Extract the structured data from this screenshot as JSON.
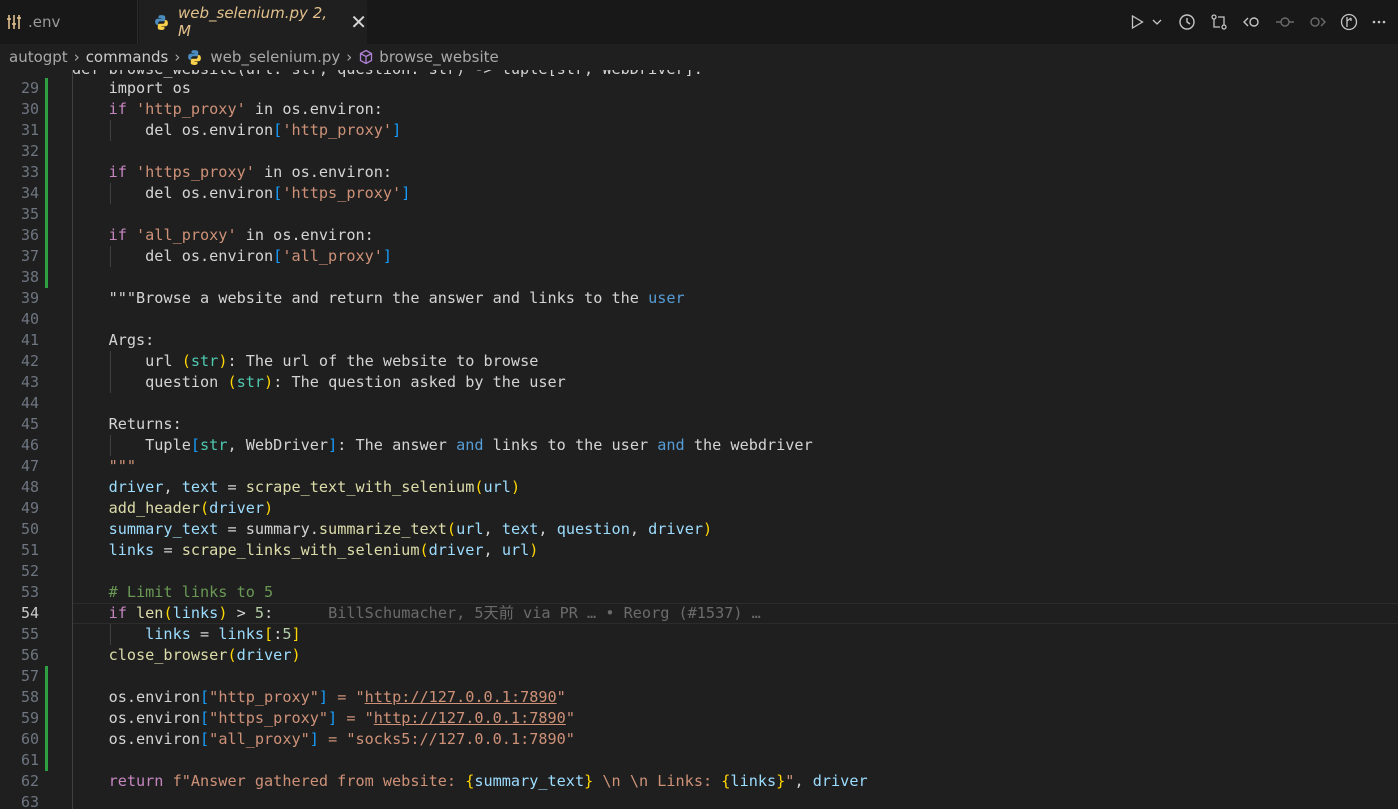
{
  "tabs": [
    {
      "label": ".env",
      "icon": "settings-sliders-icon",
      "active": false
    },
    {
      "label": "web_selenium.py",
      "status": "2, M",
      "icon": "python-icon",
      "active": true
    }
  ],
  "toolbar": {
    "icons": [
      "run-icon",
      "chevron-down-icon",
      "history-icon",
      "compare-changes-icon",
      "go-back-icon",
      "commit-icon",
      "go-forward-icon",
      "git-graph-icon",
      "more-icon"
    ]
  },
  "breadcrumb": {
    "items": [
      "autogpt",
      "commands",
      "web_selenium.py",
      "browse_website"
    ]
  },
  "editor": {
    "current_line": 54,
    "top_partial": "def browse_website(url: str, question: str) -> tuple[str, WebDriver]:",
    "last_partial_number": "63",
    "lines": [
      {
        "n": "29",
        "mod": true,
        "spans": [
          [
            "    import os",
            "d"
          ]
        ]
      },
      {
        "n": "30",
        "mod": true,
        "spans": [
          [
            "    if ",
            "k"
          ],
          [
            "'http_proxy'",
            "s"
          ],
          [
            " in os.environ:",
            "d"
          ]
        ]
      },
      {
        "n": "31",
        "mod": true,
        "spans": [
          [
            "        del os.environ",
            "d"
          ],
          [
            "[",
            "b3"
          ],
          [
            "'http_proxy'",
            "s"
          ],
          [
            "]",
            "b3"
          ]
        ]
      },
      {
        "n": "32",
        "mod": true,
        "spans": []
      },
      {
        "n": "33",
        "mod": true,
        "spans": [
          [
            "    if ",
            "k"
          ],
          [
            "'https_proxy'",
            "s"
          ],
          [
            " in os.environ:",
            "d"
          ]
        ]
      },
      {
        "n": "34",
        "mod": true,
        "spans": [
          [
            "        del os.environ",
            "d"
          ],
          [
            "[",
            "b3"
          ],
          [
            "'https_proxy'",
            "s"
          ],
          [
            "]",
            "b3"
          ]
        ]
      },
      {
        "n": "35",
        "mod": true,
        "spans": []
      },
      {
        "n": "36",
        "mod": true,
        "spans": [
          [
            "    if ",
            "k"
          ],
          [
            "'all_proxy'",
            "s"
          ],
          [
            " in os.environ:",
            "d"
          ]
        ]
      },
      {
        "n": "37",
        "mod": true,
        "spans": [
          [
            "        del os.environ",
            "d"
          ],
          [
            "[",
            "b3"
          ],
          [
            "'all_proxy'",
            "s"
          ],
          [
            "]",
            "b3"
          ]
        ]
      },
      {
        "n": "38",
        "mod": true,
        "spans": []
      },
      {
        "n": "39",
        "mod": false,
        "spans": [
          [
            "    \"\"\"Browse a website and return the answer and links to the ",
            "d"
          ],
          [
            "user",
            "bl"
          ]
        ]
      },
      {
        "n": "40",
        "mod": false,
        "spans": []
      },
      {
        "n": "41",
        "mod": false,
        "spans": [
          [
            "    Args:",
            "d"
          ]
        ]
      },
      {
        "n": "42",
        "mod": false,
        "spans": [
          [
            "        url ",
            "d"
          ],
          [
            "(",
            "b1"
          ],
          [
            "str",
            "cl"
          ],
          [
            ")",
            "b1"
          ],
          [
            ": The url of the website to browse",
            "d"
          ]
        ]
      },
      {
        "n": "43",
        "mod": false,
        "spans": [
          [
            "        question ",
            "d"
          ],
          [
            "(",
            "b1"
          ],
          [
            "str",
            "cl"
          ],
          [
            ")",
            "b1"
          ],
          [
            ": The question asked by the user",
            "d"
          ]
        ]
      },
      {
        "n": "44",
        "mod": false,
        "spans": []
      },
      {
        "n": "45",
        "mod": false,
        "spans": [
          [
            "    Returns:",
            "d"
          ]
        ]
      },
      {
        "n": "46",
        "mod": false,
        "spans": [
          [
            "        Tuple",
            "d"
          ],
          [
            "[",
            "b3"
          ],
          [
            "str",
            "cl"
          ],
          [
            ", WebDriver",
            "d"
          ],
          [
            "]",
            "b3"
          ],
          [
            ": The answer ",
            "d"
          ],
          [
            "and",
            "bl"
          ],
          [
            " links to the user ",
            "d"
          ],
          [
            "and",
            "bl"
          ],
          [
            " the webdriver",
            "d"
          ]
        ]
      },
      {
        "n": "47",
        "mod": false,
        "spans": [
          [
            "    \"\"\"",
            "s"
          ]
        ]
      },
      {
        "n": "48",
        "mod": false,
        "spans": [
          [
            "    driver",
            "v"
          ],
          [
            ", ",
            "d"
          ],
          [
            "text",
            "v"
          ],
          [
            " = ",
            "d"
          ],
          [
            "scrape_text_with_selenium",
            "f"
          ],
          [
            "(",
            "b1"
          ],
          [
            "url",
            "v"
          ],
          [
            ")",
            "b1"
          ]
        ]
      },
      {
        "n": "49",
        "mod": false,
        "spans": [
          [
            "    add_header",
            "f"
          ],
          [
            "(",
            "b1"
          ],
          [
            "driver",
            "v"
          ],
          [
            ")",
            "b1"
          ]
        ]
      },
      {
        "n": "50",
        "mod": false,
        "spans": [
          [
            "    summary_text",
            "v"
          ],
          [
            " = summary.",
            "d"
          ],
          [
            "summarize_text",
            "f"
          ],
          [
            "(",
            "b1"
          ],
          [
            "url",
            "v"
          ],
          [
            ", ",
            "d"
          ],
          [
            "text",
            "v"
          ],
          [
            ", ",
            "d"
          ],
          [
            "question",
            "v"
          ],
          [
            ", ",
            "d"
          ],
          [
            "driver",
            "v"
          ],
          [
            ")",
            "b1"
          ]
        ]
      },
      {
        "n": "51",
        "mod": false,
        "spans": [
          [
            "    links",
            "v"
          ],
          [
            " = ",
            "d"
          ],
          [
            "scrape_links_with_selenium",
            "f"
          ],
          [
            "(",
            "b1"
          ],
          [
            "driver",
            "v"
          ],
          [
            ", ",
            "d"
          ],
          [
            "url",
            "v"
          ],
          [
            ")",
            "b1"
          ]
        ]
      },
      {
        "n": "52",
        "mod": false,
        "spans": []
      },
      {
        "n": "53",
        "mod": false,
        "spans": [
          [
            "    # Limit links to 5",
            "c"
          ]
        ]
      },
      {
        "n": "54",
        "mod": false,
        "spans": [
          [
            "    if ",
            "k"
          ],
          [
            "len",
            "f"
          ],
          [
            "(",
            "b1"
          ],
          [
            "links",
            "v"
          ],
          [
            ")",
            "b1"
          ],
          [
            " > ",
            "d"
          ],
          [
            "5",
            "n"
          ],
          [
            ":",
            "d"
          ],
          [
            "      BillSchumacher, 5天前 via PR … • Reorg (#1537) …",
            "g"
          ]
        ]
      },
      {
        "n": "55",
        "mod": false,
        "spans": [
          [
            "        links",
            "v"
          ],
          [
            " = ",
            "d"
          ],
          [
            "links",
            "v"
          ],
          [
            "[",
            "b1"
          ],
          [
            ":",
            "d"
          ],
          [
            "5",
            "n"
          ],
          [
            "]",
            "b1"
          ]
        ]
      },
      {
        "n": "56",
        "mod": false,
        "spans": [
          [
            "    close_browser",
            "f"
          ],
          [
            "(",
            "b1"
          ],
          [
            "driver",
            "v"
          ],
          [
            ")",
            "b1"
          ]
        ]
      },
      {
        "n": "57",
        "mod": true,
        "spans": []
      },
      {
        "n": "58",
        "mod": true,
        "spans": [
          [
            "    os.environ",
            "d"
          ],
          [
            "[",
            "b3"
          ],
          [
            "\"http_proxy\"",
            "s"
          ],
          [
            "]",
            "b3"
          ],
          [
            " = \"",
            "s"
          ],
          [
            "http://127.0.0.1:7890",
            "u"
          ],
          [
            "\"",
            "s"
          ]
        ]
      },
      {
        "n": "59",
        "mod": true,
        "spans": [
          [
            "    os.environ",
            "d"
          ],
          [
            "[",
            "b3"
          ],
          [
            "\"https_proxy\"",
            "s"
          ],
          [
            "]",
            "b3"
          ],
          [
            " = \"",
            "s"
          ],
          [
            "http://127.0.0.1:7890",
            "u"
          ],
          [
            "\"",
            "s"
          ]
        ]
      },
      {
        "n": "60",
        "mod": true,
        "spans": [
          [
            "    os.environ",
            "d"
          ],
          [
            "[",
            "b3"
          ],
          [
            "\"all_proxy\"",
            "s"
          ],
          [
            "]",
            "b3"
          ],
          [
            " = \"socks5://127.0.0.1:7890\"",
            "s"
          ]
        ]
      },
      {
        "n": "61",
        "mod": true,
        "spans": []
      },
      {
        "n": "62",
        "mod": false,
        "spans": [
          [
            "    ",
            "d"
          ],
          [
            "return ",
            "k"
          ],
          [
            "f\"Answer gathered from website: ",
            "s"
          ],
          [
            "{",
            "b1"
          ],
          [
            "summary_text",
            "v"
          ],
          [
            "}",
            "b1"
          ],
          [
            " \\n \\n Links: ",
            "s"
          ],
          [
            "{",
            "b1"
          ],
          [
            "links",
            "v"
          ],
          [
            "}",
            "b1"
          ],
          [
            "\"",
            "s"
          ],
          [
            ", ",
            "d"
          ],
          [
            "driver",
            "v"
          ]
        ]
      }
    ]
  }
}
